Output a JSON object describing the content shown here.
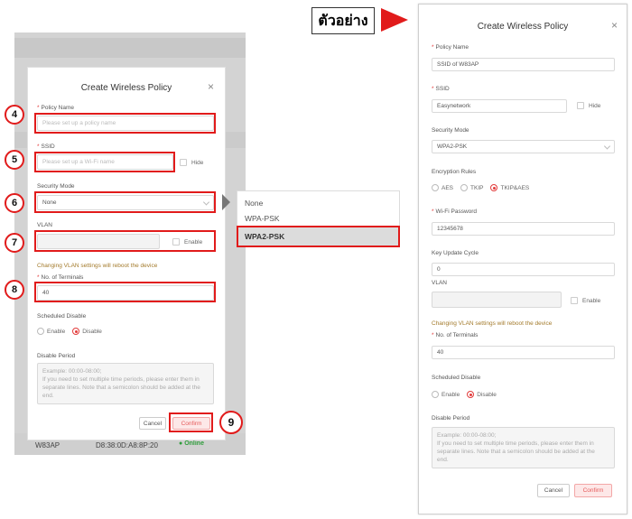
{
  "annotation": {
    "sample_label": "ตัวอย่าง"
  },
  "dialog": {
    "title": "Create Wireless Policy",
    "close": "×",
    "policy_name": {
      "label": "Policy Name",
      "placeholder": "Please set up a policy name",
      "value": "SSID of W83AP"
    },
    "ssid": {
      "label": "SSID",
      "placeholder": "Please set up a Wi-Fi name",
      "value": "Easynetwork",
      "hide_label": "Hide"
    },
    "security_mode": {
      "label": "Security Mode",
      "value_left": "None",
      "value_right": "WPA2-PSK",
      "options": [
        "None",
        "WPA-PSK",
        "WPA2-PSK"
      ]
    },
    "encryption": {
      "label": "Encryption Rules",
      "options": [
        "AES",
        "TKIP",
        "TKIP&AES"
      ],
      "selected": "TKIP&AES"
    },
    "wifi_password": {
      "label": "Wi-Fi Password",
      "value": "12345678"
    },
    "key_update": {
      "label": "Key Update Cycle",
      "value": "0"
    },
    "vlan": {
      "label": "VLAN",
      "enable_label": "Enable"
    },
    "vlan_warning": "Changing VLAN settings will reboot the device",
    "terminals": {
      "label": "No. of Terminals",
      "value": "40"
    },
    "scheduled_disable": {
      "label": "Scheduled Disable",
      "options": [
        "Enable",
        "Disable"
      ],
      "selected": "Disable"
    },
    "disable_period": {
      "label": "Disable Period",
      "left_lines": [
        "Example: 00:00-08:00;",
        "If you need to set multiple time periods, please enter them in",
        "separate lines. Note that a semicolon should be added at the",
        "end."
      ],
      "right_lines": [
        "Example: 00:00-08:00;",
        "If you need to set multiple time periods, please enter them in",
        "separate lines. Note that a semicolon should be added at the",
        "end."
      ]
    },
    "cancel_label": "Cancel",
    "confirm_label": "Confirm"
  },
  "background": {
    "device": "W83AP",
    "mac": "D8:38:0D:A8:8P:20",
    "status": "Online"
  },
  "badges": [
    "4",
    "5",
    "6",
    "7",
    "8",
    "9"
  ],
  "colors": {
    "accent": "#e11b1b",
    "warning": "#a37a2b",
    "online": "#2e9d3b"
  }
}
